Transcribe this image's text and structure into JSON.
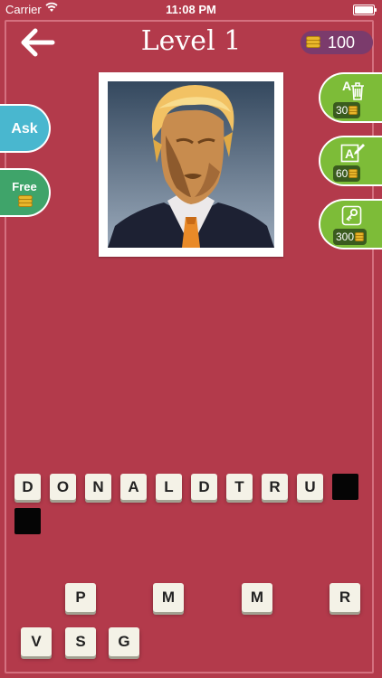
{
  "status_bar": {
    "carrier": "Carrier",
    "time": "11:08 PM"
  },
  "header": {
    "title": "Level 1",
    "coins": "100",
    "back_icon": "back-arrow-icon"
  },
  "left_buttons": {
    "ask": "Ask",
    "free": "Free"
  },
  "right_buttons": [
    {
      "icon": "remove-letters-icon",
      "cost": "30"
    },
    {
      "icon": "reveal-letter-icon",
      "cost": "60"
    },
    {
      "icon": "solve-icon",
      "cost": "300"
    }
  ],
  "answer_tiles": [
    "D",
    "O",
    "N",
    "A",
    "L",
    "D",
    "T",
    "R",
    "U",
    "",
    ""
  ],
  "letter_bank": [
    "P",
    "M",
    "M",
    "R",
    "V",
    "S",
    "G"
  ],
  "colors": {
    "background": "#b33a4b",
    "ask": "#49b7cf",
    "free": "#3fa46a",
    "hint": "#7dbc38",
    "coin_badge": "#7b3b6c"
  }
}
